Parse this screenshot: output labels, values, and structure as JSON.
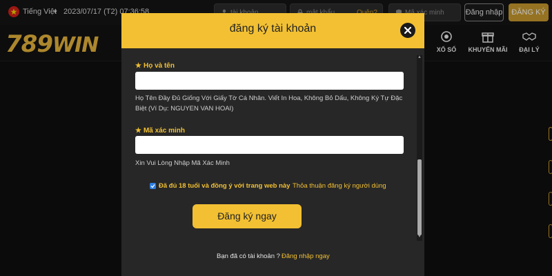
{
  "topbar": {
    "language": "Tiếng Việt",
    "datetime": "2023/07/17 (T2) 07:36:58",
    "username_placeholder": "tài khoản",
    "password_placeholder": "mật khẩu",
    "forgot_label": "Quên?",
    "captcha_placeholder": "Mã xác minh",
    "login_label": "Đăng nhập",
    "register_label": "ĐĂNG KÝ"
  },
  "brand": {
    "logo_num": "789",
    "logo_word": "WIN"
  },
  "nav": {
    "items": [
      {
        "label": "XỔ SỐ",
        "icon": "lottery-icon"
      },
      {
        "label": "KHUYẾN MÃI",
        "icon": "gift-icon"
      },
      {
        "label": "ĐẠI LÝ",
        "icon": "handshake-icon"
      }
    ]
  },
  "modal": {
    "title": "đăng ký tài khoản",
    "fullname_label": "Họ và tên",
    "fullname_hint": "Họ Tên Đầy Đủ Giống Với Giấy Tờ Cá Nhân. Viết In Hoa, Không Bỏ Dấu, Không Ký Tự Đặc Biệt (Ví Dụ: NGUYEN VAN HOAI)",
    "captcha_label": "Mã xác minh",
    "captcha_hint": "Xin Vui Lòng Nhập Mã Xác Minh",
    "agree_text": "Đã đủ 18 tuổi và đồng ý với trang web này",
    "agree_checked": true,
    "terms_link": "Thỏa thuận đăng ký người dùng",
    "submit_label": "Đăng ký ngay",
    "have_account": "Bạn đã có tài khoản ?",
    "login_link": "Đăng nhập ngay"
  },
  "colors": {
    "accent": "#f2c032",
    "modal_bg": "#272727",
    "page_bg": "#0f0f0f"
  }
}
